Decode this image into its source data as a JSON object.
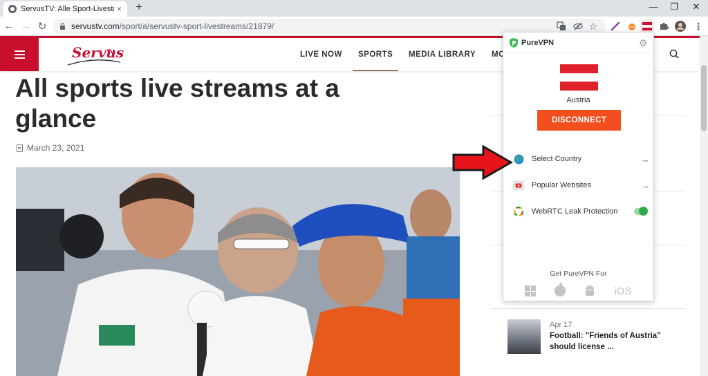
{
  "browser": {
    "tab_title": "ServusTV: Alle Sport-Livestreams",
    "tab_close": "×",
    "new_tab": "+",
    "url_host": "servustv.com",
    "url_path": "/sport/a/servustv-sport-livestreams/21879/"
  },
  "site": {
    "nav": [
      "LIVE NOW",
      "SPORTS",
      "MEDIA LIBRARY",
      "MO"
    ],
    "active_nav": "SPORTS",
    "logo_text": "Servus",
    "logo_suffix": "TV",
    "accent_color": "#c8102e"
  },
  "article": {
    "headline": "All sports live streams at a glance",
    "date": "March 23, 2021"
  },
  "sidebar": {
    "news": [
      {
        "date": "Apr 17",
        "title": "Football: \"Friends of Austria\" should license ..."
      }
    ]
  },
  "vpn": {
    "brand": "PureVPN",
    "country": "Austria",
    "disconnect_label": "DISCONNECT",
    "disconnect_color": "#f24e1e",
    "menu": [
      {
        "label": "Select Country",
        "icon": "globe-icon",
        "action": "arrow"
      },
      {
        "label": "Popular Websites",
        "icon": "play-icon",
        "action": "arrow"
      },
      {
        "label": "WebRTC Leak Protection",
        "icon": "webrtc-icon",
        "action": "toggle",
        "enabled": true
      }
    ],
    "get_for": "Get PureVPN For",
    "platforms": [
      "windows-icon",
      "apple-icon",
      "android-icon",
      "iOS"
    ],
    "ios_label": "iOS"
  }
}
